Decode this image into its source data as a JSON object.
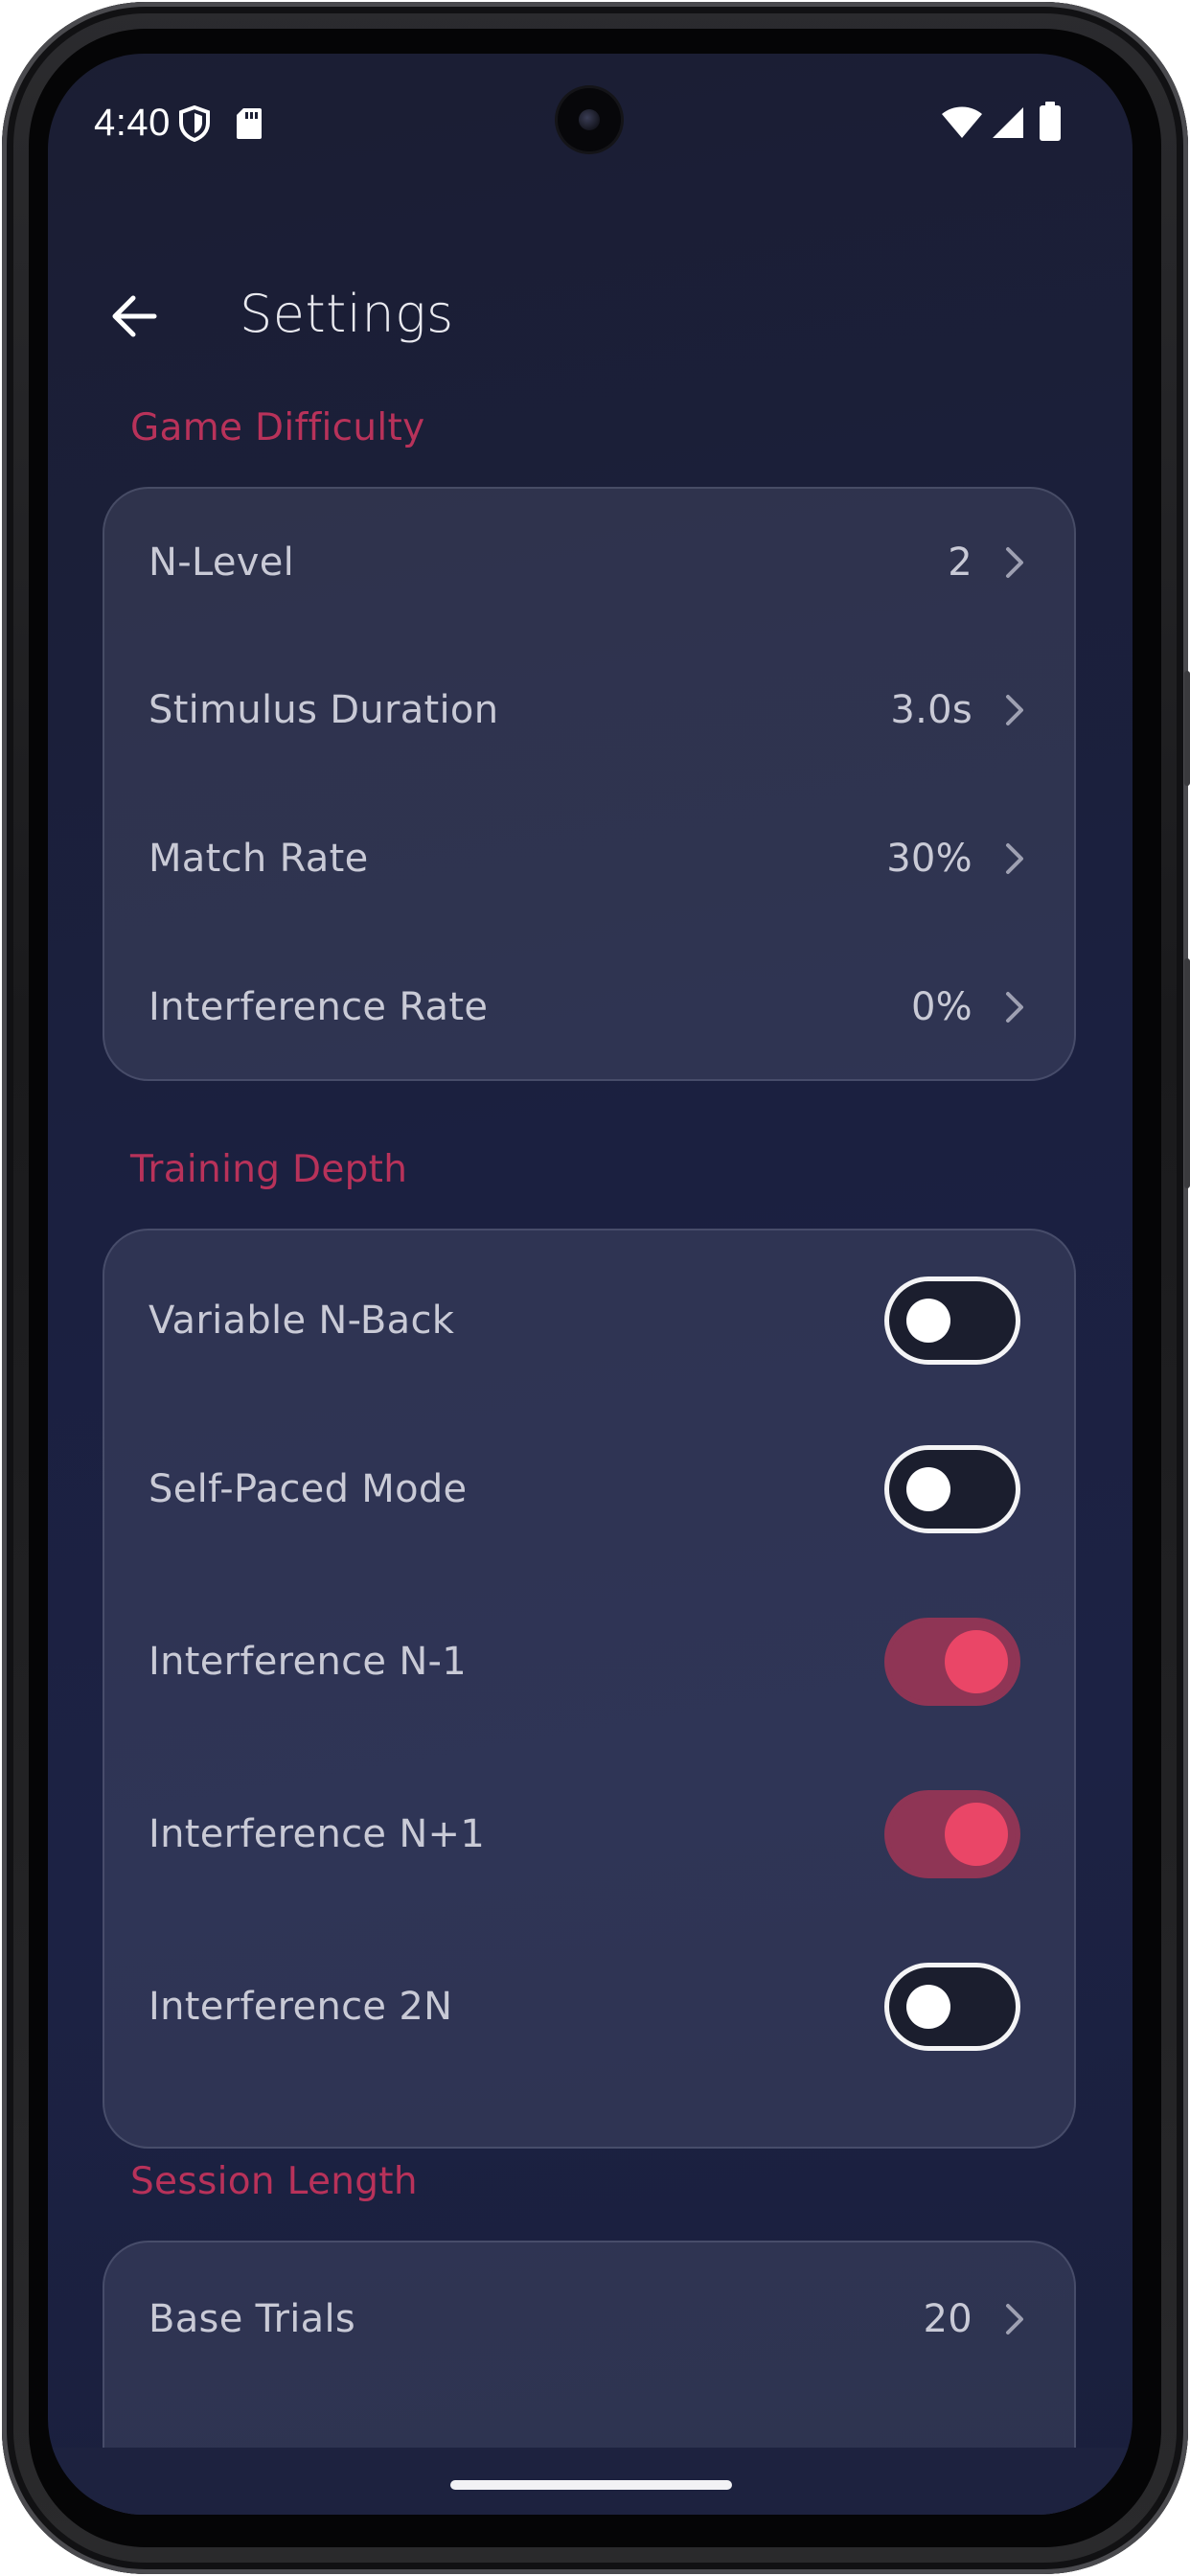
{
  "status_bar": {
    "time": "4:40",
    "icons_left": [
      "shield-icon",
      "sd-card-icon"
    ],
    "icons_right": [
      "wifi-icon",
      "cellular-signal-icon",
      "battery-icon"
    ]
  },
  "app_bar": {
    "back_icon": "arrow-left-icon",
    "title": "Settings"
  },
  "sections": {
    "game_difficulty": {
      "header": "Game Difficulty",
      "rows": [
        {
          "label": "N-Level",
          "value": "2"
        },
        {
          "label": "Stimulus Duration",
          "value": "3.0s"
        },
        {
          "label": "Match Rate",
          "value": "30%"
        },
        {
          "label": "Interference Rate",
          "value": "0%"
        }
      ]
    },
    "training_depth": {
      "header": "Training Depth",
      "toggles": [
        {
          "label": "Variable N-Back",
          "on": false
        },
        {
          "label": "Self-Paced Mode",
          "on": false
        },
        {
          "label": "Interference N-1",
          "on": true
        },
        {
          "label": "Interference N+1",
          "on": true
        },
        {
          "label": "Interference 2N",
          "on": false
        }
      ]
    },
    "session_length": {
      "header": "Session Length",
      "rows": [
        {
          "label": "Base Trials",
          "value": "20"
        }
      ]
    }
  },
  "colors": {
    "accent": "#ea4667",
    "section_header": "#b8325a",
    "background": "#1b2040",
    "toggle_track_on": "#8f3555"
  }
}
